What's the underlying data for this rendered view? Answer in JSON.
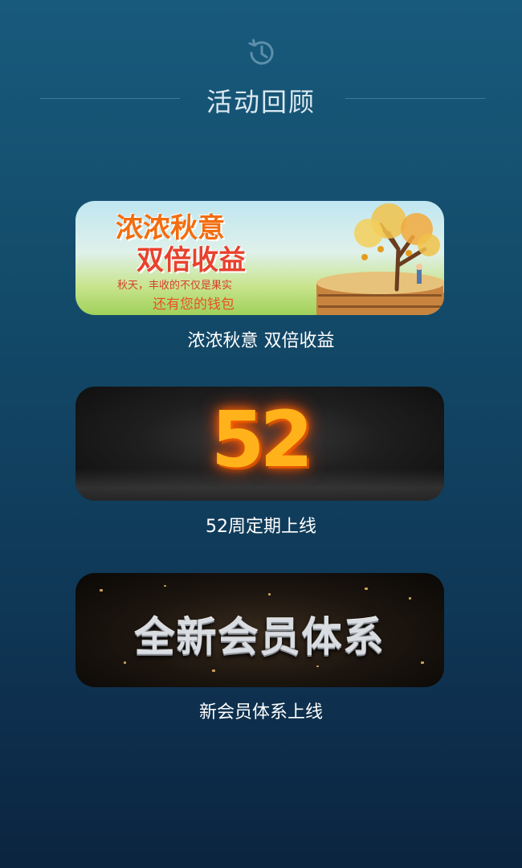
{
  "header": {
    "icon": "history-icon",
    "title": "活动回顾"
  },
  "activities": [
    {
      "caption": "浓浓秋意 双倍收益",
      "banner": {
        "line1": "浓浓秋意",
        "line2": "双倍收益",
        "sub1": "秋天，丰收的不仅是果实",
        "sub2": "还有您的钱包"
      }
    },
    {
      "caption": "52周定期上线",
      "banner": {
        "text": "52"
      }
    },
    {
      "caption": "新会员体系上线",
      "banner": {
        "text": "全新会员体系"
      }
    }
  ],
  "colors": {
    "background_top": "#185a7c",
    "background_bottom": "#0b2440",
    "title": "#dbe9f2",
    "divider": "#3d7a99"
  }
}
